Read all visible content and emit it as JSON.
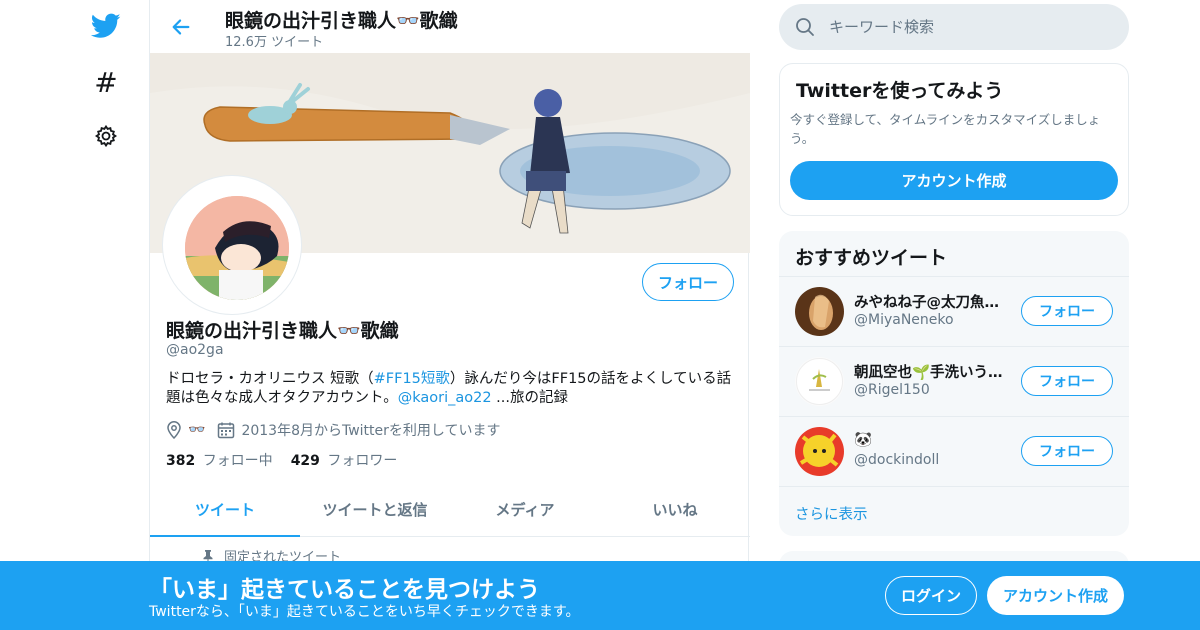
{
  "colors": {
    "accent": "#1da1f2",
    "link": "#1b95e0",
    "muted": "#657786",
    "text": "#14171a"
  },
  "nav": {
    "icons": [
      "twitter-bird-icon",
      "hashtag-icon",
      "gear-icon"
    ],
    "hashtag_glyph": "#"
  },
  "header": {
    "name": "眼鏡の出汁引き職人👓歌織",
    "tweet_count": "12.6万 ツイート"
  },
  "profile": {
    "name": "眼鏡の出汁引き職人👓歌織",
    "handle": "@ao2ga",
    "bio": {
      "t1": "ドロセラ・カオリニウス 短歌（",
      "l1": "#FF15短歌",
      "t2": "）詠んだり今はFF15の話をよくしている話題は色々な成人オタクアカウント。",
      "l2": "@kaori_ao22",
      "t3": " ...旅の記録"
    },
    "location": "👓",
    "joined": "2013年8月からTwitterを利用しています",
    "following_count": "382",
    "following_label": "フォロー中",
    "followers_count": "429",
    "followers_label": "フォロワー",
    "follow_label": "フォロー"
  },
  "tabs": [
    {
      "label": "ツイート",
      "active": true
    },
    {
      "label": "ツイートと返信",
      "active": false
    },
    {
      "label": "メディア",
      "active": false
    },
    {
      "label": "いいね",
      "active": false
    }
  ],
  "pinned_label": "固定されたツイート",
  "search": {
    "placeholder": "キーワード検索"
  },
  "signup_card": {
    "title": "Twitterを使ってみよう",
    "desc": "今すぐ登録して、タイムラインをカスタマイズしましょう。",
    "button": "アカウント作成"
  },
  "recommend": {
    "title": "おすすめツイート",
    "follow_label": "フォロー",
    "users": [
      {
        "name": "みやねね子@太刀魚…",
        "handle": "@MiyaNeneko"
      },
      {
        "name": "朝凪空也🌱手洗いう…",
        "handle": "@Rigel150"
      },
      {
        "name": "🐼",
        "handle": "@dockindoll"
      }
    ],
    "more": "さらに表示"
  },
  "bottom_bar": {
    "headline": "「いま」起きていることを見つけよう",
    "sub": "Twitterなら、「いま」起きていることをいち早くチェックできます。",
    "login": "ログイン",
    "signup": "アカウント作成"
  }
}
